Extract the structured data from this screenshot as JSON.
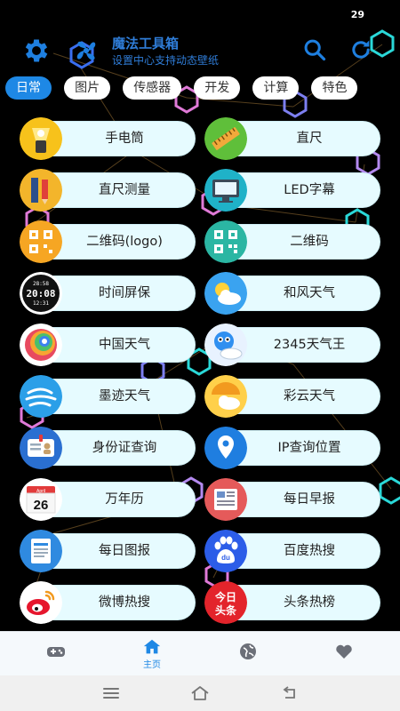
{
  "statusbar": {
    "time": "29"
  },
  "header": {
    "title": "魔法工具箱",
    "subtitle": "设置中心支持动态壁纸",
    "icons": [
      "gear-icon",
      "fan-icon",
      "search-icon",
      "refresh-icon"
    ]
  },
  "tabs": [
    {
      "label": "日常",
      "active": true
    },
    {
      "label": "图片",
      "active": false
    },
    {
      "label": "传感器",
      "active": false
    },
    {
      "label": "开发",
      "active": false
    },
    {
      "label": "计算",
      "active": false
    },
    {
      "label": "特色",
      "active": false
    }
  ],
  "tools": [
    {
      "label": "手电筒",
      "icon": "flashlight-icon"
    },
    {
      "label": "直尺",
      "icon": "ruler-icon"
    },
    {
      "label": "直尺测量",
      "icon": "pencil-ruler-icon"
    },
    {
      "label": "LED字幕",
      "icon": "monitor-icon"
    },
    {
      "label": "二维码(logo)",
      "icon": "qrcode-logo-icon"
    },
    {
      "label": "二维码",
      "icon": "qrcode-icon"
    },
    {
      "label": "时间屏保",
      "icon": "digital-clock-icon"
    },
    {
      "label": "和风天气",
      "icon": "sun-cloud-icon"
    },
    {
      "label": "中国天气",
      "icon": "rainbow-swirl-icon"
    },
    {
      "label": "2345天气王",
      "icon": "bird-cloud-icon"
    },
    {
      "label": "墨迹天气",
      "icon": "wind-cloud-icon"
    },
    {
      "label": "彩云天气",
      "icon": "umbrella-cloud-icon"
    },
    {
      "label": "身份证查询",
      "icon": "id-card-icon"
    },
    {
      "label": "IP查询位置",
      "icon": "location-pin-icon"
    },
    {
      "label": "万年历",
      "icon": "calendar-icon"
    },
    {
      "label": "每日早报",
      "icon": "newspaper-icon"
    },
    {
      "label": "每日图报",
      "icon": "document-icon"
    },
    {
      "label": "百度热搜",
      "icon": "baidu-paw-icon"
    },
    {
      "label": "微博热搜",
      "icon": "weibo-icon"
    },
    {
      "label": "头条热榜",
      "icon": "toutiao-icon"
    }
  ],
  "calendar_icon": {
    "month": "April",
    "day": "26"
  },
  "clock_icon": {
    "top": "28:58",
    "main": "20:08",
    "bottom": "12:31"
  },
  "toutiao_icon": {
    "line1": "今日",
    "line2": "头条"
  },
  "baidu_icon": {
    "text": "du"
  },
  "bottom_nav": [
    {
      "label": "",
      "icon": "gamepad-icon"
    },
    {
      "label": "主页",
      "icon": "home-icon",
      "active": true
    },
    {
      "label": "",
      "icon": "globe-icon"
    },
    {
      "label": "",
      "icon": "heart-icon"
    }
  ],
  "system_bar": [
    "menu-icon",
    "home-outline-icon",
    "back-icon"
  ],
  "colors": {
    "accent": "#1e88e5",
    "pill": "#e6fbff",
    "title": "#2f7dd8"
  }
}
